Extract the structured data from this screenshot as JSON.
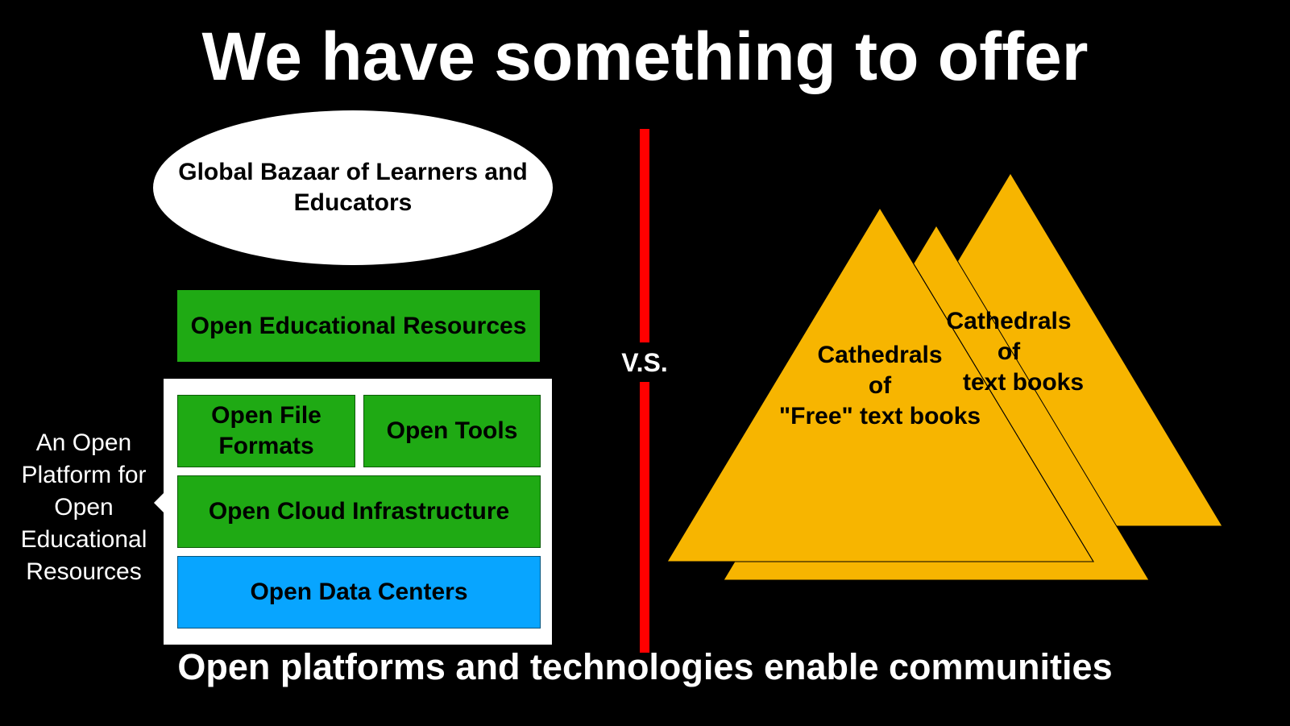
{
  "title": "We have something to offer",
  "subtitle": "Open platforms and technologies enable communities",
  "bazaar": "Global Bazaar of Learners and Educators",
  "stack": {
    "oer": "Open Educational Resources",
    "file_formats": "Open File Formats",
    "tools": "Open Tools",
    "cloud": "Open Cloud Infrastructure",
    "data_centers": "Open Data Centers"
  },
  "callout": "An Open Platform for Open Educational Resources",
  "vs": "V.S.",
  "cathedrals": {
    "back_line1": "Cathedrals",
    "back_line2": "of",
    "back_line3": "text books",
    "front_line1": "Cathedrals",
    "front_line2": "of",
    "front_line3": "\"Free\" text books"
  },
  "colors": {
    "background": "#000000",
    "green": "#1faa14",
    "blue": "#08a5ff",
    "divider": "#ff0000",
    "triangle": "#f7b500"
  }
}
